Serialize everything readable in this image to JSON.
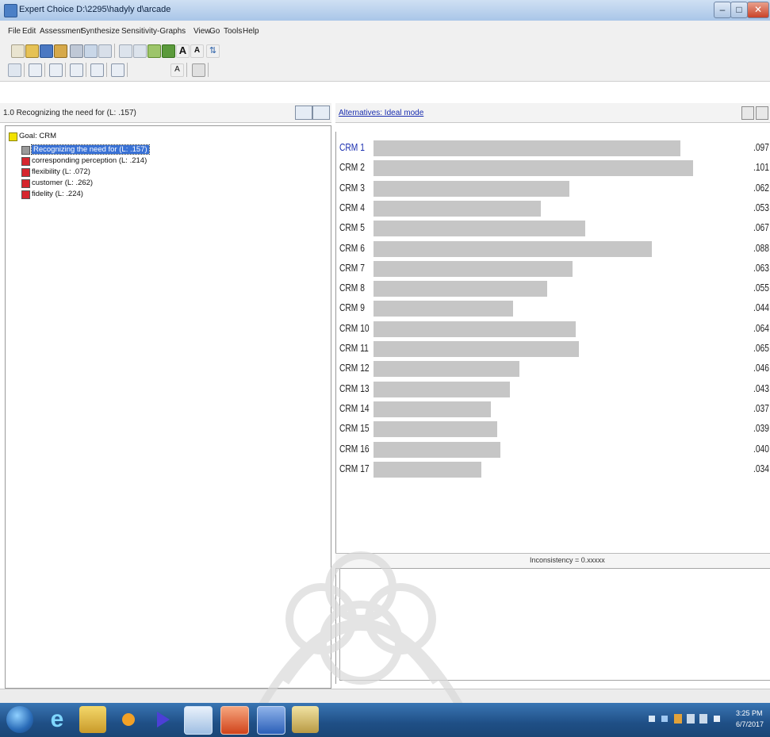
{
  "window": {
    "title": "Expert Choice   D:\\2295\\hadyly d\\arcade",
    "colors": {
      "titlebar": "#a9c6e8",
      "close": "#c9432a"
    }
  },
  "menu": {
    "items": [
      "File",
      "Edit",
      "Assessment",
      "Synthesize",
      "Sensitivity-Graphs",
      "View",
      "Go",
      "Tools",
      "Help"
    ]
  },
  "left_pane": {
    "header": "1.0 Recognizing the need for (L: .157)",
    "tree": {
      "goal": "Goal: CRM",
      "children": [
        {
          "label": "Recognizing the need for (L: .157)",
          "selected": true
        },
        {
          "label": "corresponding perception (L: .214)",
          "selected": false
        },
        {
          "label": "flexibility (L: .072)",
          "selected": false
        },
        {
          "label": "customer (L: .262)",
          "selected": false
        },
        {
          "label": "fidelity (L: .224)",
          "selected": false
        }
      ]
    }
  },
  "right_pane": {
    "header": "Alternatives: Ideal mode",
    "inconsistency": "Inconsistency = 0.xxxxx",
    "alternatives": [
      {
        "label": "CRM 1",
        "value": ".097",
        "weight": 0.097
      },
      {
        "label": "CRM 2",
        "value": ".101",
        "weight": 0.101
      },
      {
        "label": "CRM 3",
        "value": ".062",
        "weight": 0.062
      },
      {
        "label": "CRM 4",
        "value": ".053",
        "weight": 0.053
      },
      {
        "label": "CRM 5",
        "value": ".067",
        "weight": 0.067
      },
      {
        "label": "CRM 6",
        "value": ".088",
        "weight": 0.088
      },
      {
        "label": "CRM 7",
        "value": ".063",
        "weight": 0.063
      },
      {
        "label": "CRM 8",
        "value": ".055",
        "weight": 0.055
      },
      {
        "label": "CRM 9",
        "value": ".044",
        "weight": 0.044
      },
      {
        "label": "CRM 10",
        "value": ".064",
        "weight": 0.064
      },
      {
        "label": "CRM 11",
        "value": ".065",
        "weight": 0.065
      },
      {
        "label": "CRM 12",
        "value": ".046",
        "weight": 0.046
      },
      {
        "label": "CRM 13",
        "value": ".043",
        "weight": 0.043
      },
      {
        "label": "CRM 14",
        "value": ".037",
        "weight": 0.037
      },
      {
        "label": "CRM 15",
        "value": ".039",
        "weight": 0.039
      },
      {
        "label": "CRM 16",
        "value": ".040",
        "weight": 0.04
      },
      {
        "label": "CRM 17",
        "value": ".034",
        "weight": 0.034
      }
    ],
    "bar_color": "#c6c6c6",
    "selected_text_color": "#1b2fb0"
  },
  "taskbar": {
    "time": "3:25 PM",
    "date": "6/7/2017",
    "apps": [
      "start-orb",
      "internet-explorer",
      "file-explorer",
      "media-center",
      "media-player",
      "expert-choice",
      "powerpoint",
      "word",
      "paint"
    ]
  }
}
